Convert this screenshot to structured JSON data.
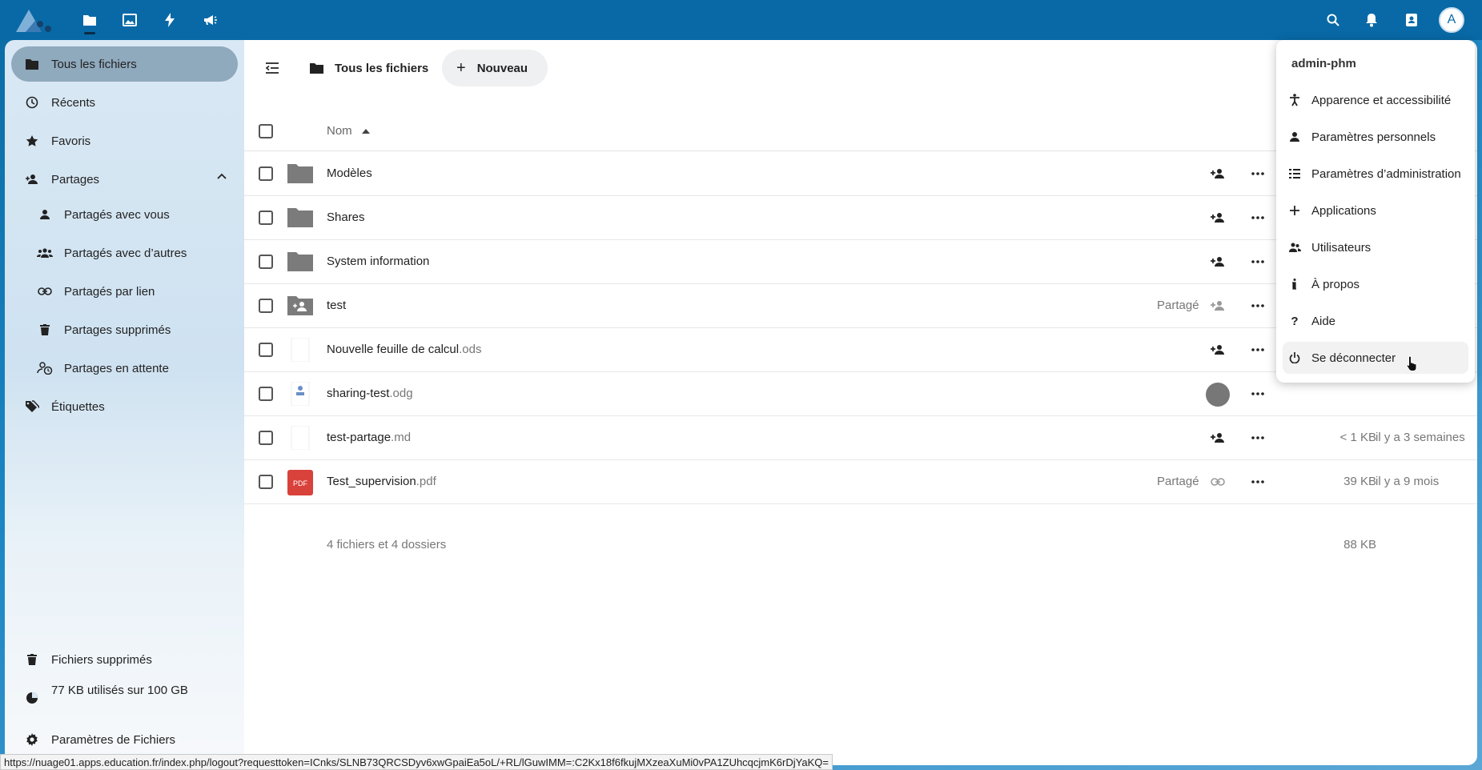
{
  "topbar": {
    "apps": [
      "files-icon",
      "photos-icon",
      "activity-icon",
      "announcements-icon"
    ],
    "avatar_letter": "A"
  },
  "sidebar": {
    "items": [
      {
        "label": "Tous les fichiers",
        "icon": "folder-icon"
      },
      {
        "label": "Récents",
        "icon": "history-icon"
      },
      {
        "label": "Favoris",
        "icon": "star-icon"
      },
      {
        "label": "Partages",
        "icon": "share-icon"
      },
      {
        "label": "Partagés avec vous",
        "icon": "person-icon"
      },
      {
        "label": "Partagés avec d’autres",
        "icon": "group-icon"
      },
      {
        "label": "Partagés par lien",
        "icon": "link-icon"
      },
      {
        "label": "Partages supprimés",
        "icon": "trash-icon"
      },
      {
        "label": "Partages en attente",
        "icon": "pending-icon"
      },
      {
        "label": "Étiquettes",
        "icon": "tag-icon"
      }
    ],
    "bottom": {
      "deleted": "Fichiers supprimés",
      "quota": "77 KB utilisés sur 100 GB",
      "settings": "Paramètres de Fichiers"
    }
  },
  "main": {
    "breadcrumb": "Tous les fichiers",
    "new_button": "Nouveau",
    "column_name": "Nom",
    "files": [
      {
        "name": "Modèles",
        "ext": "",
        "type": "folder",
        "shared": "",
        "share_icon": "share-add-icon",
        "size": "",
        "date": ""
      },
      {
        "name": "Shares",
        "ext": "",
        "type": "folder",
        "shared": "",
        "share_icon": "share-add-icon",
        "size": "",
        "date": ""
      },
      {
        "name": "System information",
        "ext": "",
        "type": "folder",
        "shared": "",
        "share_icon": "share-add-icon",
        "size": "",
        "date": ""
      },
      {
        "name": "test",
        "ext": "",
        "type": "shared-folder",
        "shared": "Partagé",
        "share_icon": "share-add-icon",
        "size": "",
        "date": ""
      },
      {
        "name": "Nouvelle feuille de calcul",
        "ext": ".ods",
        "type": "blank",
        "shared": "",
        "share_icon": "share-add-icon",
        "size": "",
        "date": ""
      },
      {
        "name": "sharing-test",
        "ext": ".odg",
        "type": "odg",
        "shared": "",
        "share_icon": "avatar-circle",
        "size": "",
        "date": ""
      },
      {
        "name": "test-partage",
        "ext": ".md",
        "type": "blank",
        "shared": "",
        "share_icon": "share-add-icon",
        "size": "< 1 KB",
        "date": "il y a 3 semaines"
      },
      {
        "name": "Test_supervision",
        "ext": ".pdf",
        "type": "pdf",
        "shared": "Partagé",
        "share_icon": "link-icon",
        "size": "39 KB",
        "date": "il y a 9 mois"
      }
    ],
    "summary": "4 fichiers et 4 dossiers",
    "total_size": "88 KB",
    "pdf_badge": "PDF"
  },
  "user_menu": {
    "username": "admin-phm",
    "items": [
      {
        "label": "Apparence et accessibilité",
        "icon": "accessibility-icon"
      },
      {
        "label": "Paramètres personnels",
        "icon": "person-icon"
      },
      {
        "label": "Paramètres d’administration",
        "icon": "admin-list-icon"
      },
      {
        "label": "Applications",
        "icon": "plus-icon"
      },
      {
        "label": "Utilisateurs",
        "icon": "group-icon"
      },
      {
        "label": "À propos",
        "icon": "info-icon"
      },
      {
        "label": "Aide",
        "icon": "help-icon"
      },
      {
        "label": "Se déconnecter",
        "icon": "power-icon"
      }
    ]
  },
  "statusbar": {
    "url": "https://nuage01.apps.education.fr/index.php/logout?requesttoken=ICnks/SLNB73QRCSDyv6xwGpaiEa5oL/+RL/lGuwIMM=:C2Kx18f6fkujMXzeaXuMi0vPA1ZUhcqcjmK6rDjYaKQ="
  },
  "colors": {
    "header": "#0869a6",
    "active_nav": "#8fa9bd",
    "pdf_red": "#d9413b"
  }
}
